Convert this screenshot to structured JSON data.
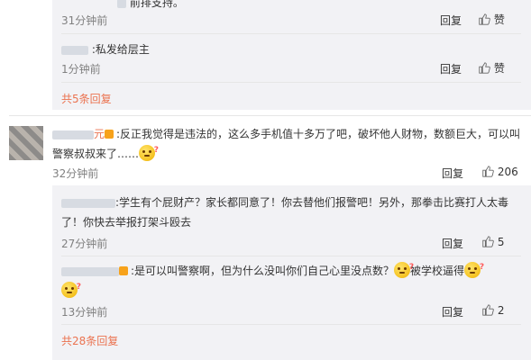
{
  "top_reply": {
    "text_tail": "前排支持。",
    "time": "31分钟前",
    "reply_label": "回复",
    "like_label": "赞"
  },
  "reply2": {
    "text": ":私发给层主",
    "time": "1分钟前",
    "reply_label": "回复",
    "like_label": "赞"
  },
  "thread1_more": "共5条回复",
  "main_comment": {
    "text": ":反正我觉得是违法的，这么多手机值十多万了吧，破坏他人财物，数额巨大，可以叫警察叔叔来了……",
    "time": "32分钟前",
    "reply_label": "回复",
    "like_count": "206"
  },
  "sub1": {
    "text": ":学生有个屁财产？家长都同意了！你去替他们报警吧！另外，那拳击比赛打人太毒了！你快去举报打架斗殴去",
    "time": "27分钟前",
    "reply_label": "回复",
    "like_count": "5"
  },
  "sub2": {
    "text_a": ":是可以叫警察啊，但为什么没叫你们自己心里没点数？",
    "text_b": "被学校逼得",
    "time": "13分钟前",
    "reply_label": "回复",
    "like_count": "2"
  },
  "thread2_more": "共28条回复",
  "icons": {
    "like": "thumbs-up-icon",
    "emoji": "thinking-emoji-icon"
  },
  "colors": {
    "link": "#eb7350",
    "background_reply": "#f2f2f5"
  }
}
